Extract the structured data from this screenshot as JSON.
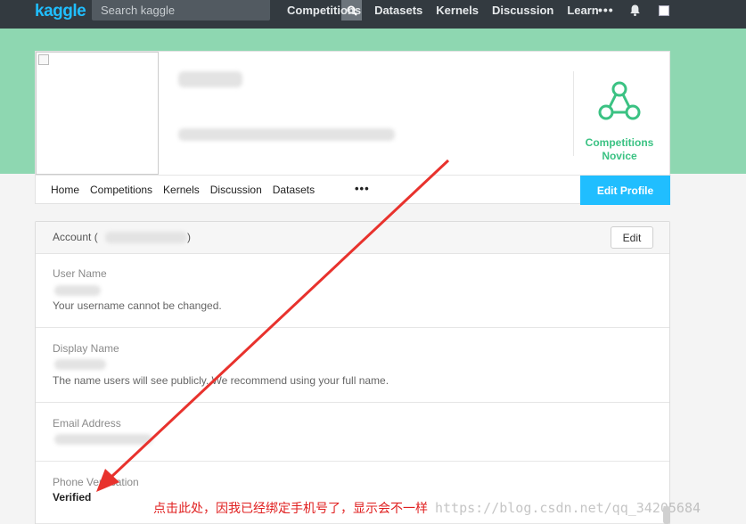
{
  "topbar": {
    "logo": "kaggle",
    "search_placeholder": "Search kaggle",
    "nav": [
      "Competitions",
      "Datasets",
      "Kernels",
      "Discussion",
      "Learn"
    ],
    "more": "•••"
  },
  "profile": {
    "tier": "Competitions Novice",
    "tabs": [
      "Home",
      "Competitions",
      "Kernels",
      "Discussion",
      "Datasets"
    ],
    "more": "•••",
    "edit_profile": "Edit Profile"
  },
  "account": {
    "title_open": "Account (",
    "title_close": ")",
    "edit_label": "Edit",
    "fields": [
      {
        "label": "User Name",
        "note": "Your username cannot be changed."
      },
      {
        "label": "Display Name",
        "note": "The name users will see publicly. We recommend using your full name."
      },
      {
        "label": "Email Address"
      },
      {
        "label": "Phone Verification",
        "value": "Verified"
      }
    ]
  },
  "annotation": {
    "note": "点击此处，因我已经绑定手机号了，显示会不一样",
    "watermark": "https://blog.csdn.net/qq_34205684",
    "arrow_color": "#e8322d"
  },
  "colors": {
    "topbar": "#333a40",
    "brand": "#20beff",
    "band": "#8ed7b1",
    "tier": "#3bc283"
  }
}
